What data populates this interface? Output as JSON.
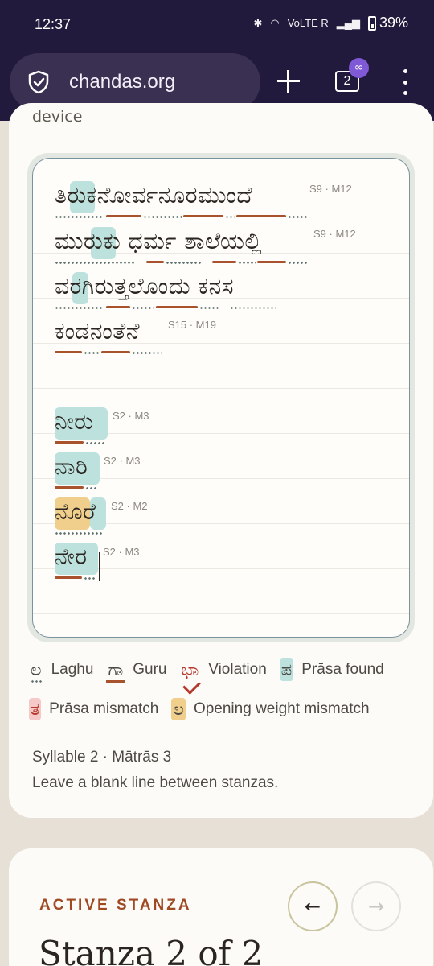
{
  "status_bar": {
    "time": "12:37",
    "battery": "39%",
    "network_labels": "VoLTE R"
  },
  "browser": {
    "url": "chandas.org",
    "tab_count": "2",
    "tab_badge": "∞"
  },
  "page": {
    "cut_off_text": "device",
    "editor": {
      "stanza1": [
        {
          "text": "ತಿರುಕನೋರ್ವನೂರಮುಂದೆ",
          "meta": "S9 · M12"
        },
        {
          "text": "ಮುರುಕು ಧರ್ಮ ಶಾಲೆಯಲ್ಲಿ",
          "meta": "S9 · M12"
        },
        {
          "text": "ವರಗಿರುತ್ತಲೊಂದು ಕನಸ",
          "meta": ""
        },
        {
          "text": "ಕಂಡನಂತೆನೆ",
          "meta": "S15 · M19"
        }
      ],
      "stanza2": [
        {
          "text": "ನೀರು",
          "meta": "S2 · M3"
        },
        {
          "text": "ನಾರಿ",
          "meta": "S2 · M3"
        },
        {
          "text": "ನೊರೆ",
          "meta": "S2 · M2"
        },
        {
          "text": "ನೇರ",
          "meta": "S2 · M3"
        }
      ]
    },
    "legend": {
      "laghu": {
        "symbol": "ಲ",
        "label": "Laghu"
      },
      "guru": {
        "symbol": "ಗಾ",
        "label": "Guru"
      },
      "violation": {
        "symbol": "ಭಾ",
        "label": "Violation"
      },
      "prasa_found": {
        "symbol": "ಪ",
        "label": "Prāsa found"
      },
      "prasa_mismatch": {
        "symbol": "ತ",
        "label": "Prāsa mismatch"
      },
      "opening_mismatch": {
        "symbol": "ಲ",
        "label": "Opening weight mismatch"
      }
    },
    "info": {
      "syllable_line": "Syllable 2 · Mātrās 3",
      "hint": "Leave a blank line between stanzas."
    },
    "active_stanza": {
      "eyebrow": "ACTIVE STANZA",
      "title": "Stanza 2 of 2",
      "prev": "←",
      "next": "→"
    }
  },
  "colors": {
    "chrome": "#221a3c",
    "guru": "#a8532e",
    "prasa": "#bde2dd",
    "mismatch": "#f4c9c8",
    "opening": "#f0cf8c",
    "accent": "#a04a24"
  }
}
